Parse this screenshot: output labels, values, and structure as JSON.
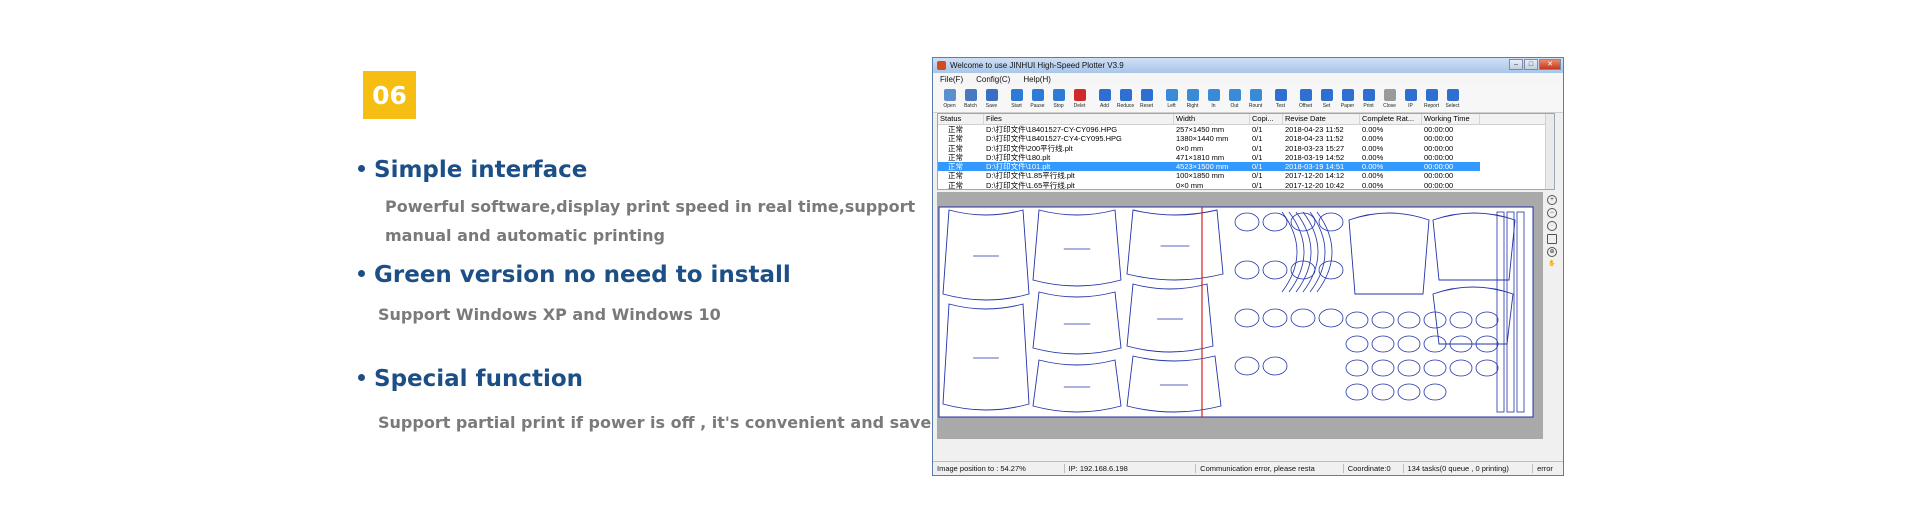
{
  "badge": "06",
  "features": [
    {
      "title": "Simple interface",
      "desc_lines": [
        "Powerful software,display print speed in real time,support",
        "manual and automatic printing"
      ]
    },
    {
      "title": "Green version no need to install",
      "desc_lines": [
        "Support Windows XP and Windows 10"
      ]
    },
    {
      "title": "Special function",
      "desc_lines": [
        "Support partial print if power is off , it's convenient and save cost"
      ]
    }
  ],
  "window": {
    "title": "Welcome to use JINHUI High-Speed Plotter V3.9",
    "menu": [
      "File(F)",
      "Config(C)",
      "Help(H)"
    ],
    "toolbar": [
      {
        "label": "Open",
        "icon": "open-icon",
        "color": "#5b8fd0"
      },
      {
        "label": "Batch",
        "icon": "batch-icon",
        "color": "#4a78c0"
      },
      {
        "label": "Save",
        "icon": "save-icon",
        "color": "#3a6fc6"
      },
      {
        "label": "Start",
        "icon": "start-icon",
        "color": "#2d7bd6"
      },
      {
        "label": "Pause",
        "icon": "pause-icon",
        "color": "#2d7bd6"
      },
      {
        "label": "Stop",
        "icon": "stop-icon",
        "color": "#2d7bd6"
      },
      {
        "label": "Delet",
        "icon": "delete-icon",
        "color": "#d22a2a"
      },
      {
        "label": "Add",
        "icon": "add-icon",
        "color": "#2f6fd1"
      },
      {
        "label": "Reduce",
        "icon": "reduce-icon",
        "color": "#2f6fd1"
      },
      {
        "label": "Reset",
        "icon": "reset-icon",
        "color": "#2f6fd1"
      },
      {
        "label": "Left",
        "icon": "arrow-left-icon",
        "color": "#3a8ad8"
      },
      {
        "label": "Right",
        "icon": "arrow-right-icon",
        "color": "#3a8ad8"
      },
      {
        "label": "In",
        "icon": "arrow-in-icon",
        "color": "#3a8ad8"
      },
      {
        "label": "Out",
        "icon": "arrow-out-icon",
        "color": "#3a8ad8"
      },
      {
        "label": "Rount",
        "icon": "rotate-icon",
        "color": "#3a8ad8"
      },
      {
        "label": "Test",
        "icon": "test-icon",
        "color": "#2f6fd1"
      },
      {
        "label": "Offset",
        "icon": "offset-icon",
        "color": "#2f6fd1"
      },
      {
        "label": "Set",
        "icon": "settings-icon",
        "color": "#2f6fd1"
      },
      {
        "label": "Paper",
        "icon": "paper-icon",
        "color": "#2f6fd1"
      },
      {
        "label": "Print",
        "icon": "print-icon",
        "color": "#2f6fd1"
      },
      {
        "label": "Close",
        "icon": "close-icon",
        "color": "#9a9a9a"
      },
      {
        "label": "IP",
        "icon": "ip-icon",
        "color": "#2f6fd1"
      },
      {
        "label": "Report",
        "icon": "report-icon",
        "color": "#2f6fd1"
      },
      {
        "label": "Select",
        "icon": "select-icon",
        "color": "#2f6fd1"
      }
    ],
    "columns": [
      "Status",
      "Files",
      "Width",
      "Copi...",
      "Revise Date",
      "Complete Rat...",
      "Working Time"
    ],
    "rows": [
      [
        "正常",
        "D:\\打印文件\\18401527-CY-CY096.HPG",
        "257×1450 mm",
        "0/1",
        "2018-04-23 11:52",
        "0.00%",
        "00:00:00"
      ],
      [
        "正常",
        "D:\\打印文件\\18401527-CY4-CY095.HPG",
        "1380×1440 mm",
        "0/1",
        "2018-04-23 11:52",
        "0.00%",
        "00:00:00"
      ],
      [
        "正常",
        "D:\\打印文件\\200平行线.plt",
        "0×0 mm",
        "0/1",
        "2018-03-23 15:27",
        "0.00%",
        "00:00:00"
      ],
      [
        "正常",
        "D:\\打印文件\\180.plt",
        "471×1810 mm",
        "0/1",
        "2018-03-19 14:52",
        "0.00%",
        "00:00:00"
      ],
      [
        "正常",
        "D:\\打印文件\\101.plt",
        "4523×1500 mm",
        "0/1",
        "2018-03-19 14:51",
        "0.00%",
        "00:00:00"
      ],
      [
        "正常",
        "D:\\打印文件\\1.85平行线.plt",
        "100×1850 mm",
        "0/1",
        "2017-12-20 14:12",
        "0.00%",
        "00:00:00"
      ],
      [
        "正常",
        "D:\\打印文件\\1.65平行线.plt",
        "0×0 mm",
        "0/1",
        "2017-12-20 10:42",
        "0.00%",
        "00:00:00"
      ]
    ],
    "selected_row": 4,
    "status": [
      "Image position to : 54.27%",
      "IP: 192.168.6.198",
      "Communication error, please resta",
      "Coordinate:0",
      "134 tasks(0 queue , 0 printing)",
      "error"
    ],
    "colors": {
      "pattern_stroke": "#2233aa",
      "cut_line": "#d42020",
      "selection": "#3399ff"
    }
  }
}
